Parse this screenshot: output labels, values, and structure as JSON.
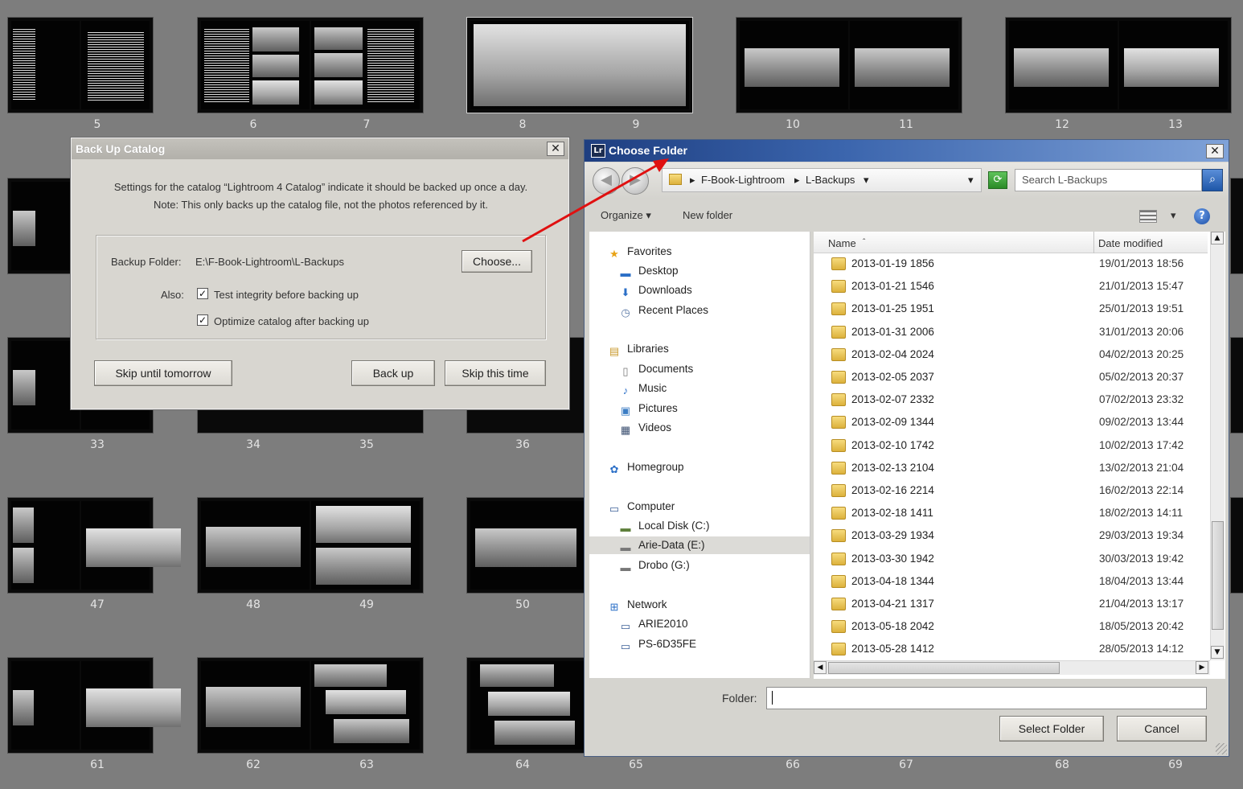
{
  "page_numbers": [
    "5",
    "6",
    "7",
    "8",
    "9",
    "10",
    "11",
    "12",
    "13",
    "33",
    "34",
    "35",
    "36",
    "47",
    "48",
    "49",
    "50",
    "61",
    "62",
    "63",
    "64",
    "65",
    "66",
    "67",
    "68",
    "69"
  ],
  "backup_dialog": {
    "title": "Back Up Catalog",
    "close": "✕",
    "message_line1": "Settings for the catalog “Lightroom 4 Catalog” indicate it should be backed up once a day.",
    "message_line2": "Note: This only backs up the catalog file, not the photos referenced by it.",
    "folder_label": "Backup Folder:",
    "folder_path": "E:\\F-Book-Lightroom\\L-Backups",
    "choose_button": "Choose...",
    "also_label": "Also:",
    "check_integrity": "Test integrity before backing up",
    "check_optimize": "Optimize catalog after backing up",
    "check_mark": "✓",
    "skip_tomorrow": "Skip until tomorrow",
    "back_up": "Back up",
    "skip_time": "Skip this time"
  },
  "choose_dialog": {
    "title": "Choose Folder",
    "app_badge": "Lr",
    "close": "✕",
    "back_glyph": "◀",
    "forward_glyph": "▶",
    "address": {
      "separator": "▸",
      "dropdown": "▾",
      "segments": [
        "F-Book-Lightroom",
        "L-Backups"
      ]
    },
    "refresh_glyph": "⟳",
    "search_placeholder": "Search L-Backups",
    "search_glyph": "⌕",
    "toolbar": {
      "organize": "Organize ▾",
      "new_folder": "New folder",
      "view_dropdown": "▾",
      "help": "?"
    },
    "nav": {
      "favorites": "Favorites",
      "desktop": "Desktop",
      "downloads": "Downloads",
      "recent": "Recent Places",
      "libraries": "Libraries",
      "documents": "Documents",
      "music": "Music",
      "pictures": "Pictures",
      "videos": "Videos",
      "homegroup": "Homegroup",
      "computer": "Computer",
      "local_disk": "Local Disk (C:)",
      "arie_data": "Arie-Data (E:)",
      "drobo": "Drobo (G:)",
      "network": "Network",
      "arie2010": "ARIE2010",
      "ps": "PS-6D35FE"
    },
    "columns": {
      "name": "Name",
      "sort": "ˆ",
      "date": "Date modified"
    },
    "scroll": {
      "up": "▲",
      "down": "▼",
      "left": "◀",
      "right": "▶"
    },
    "files": [
      {
        "name": "2013-01-19 1856",
        "date": "19/01/2013 18:56"
      },
      {
        "name": "2013-01-21 1546",
        "date": "21/01/2013 15:47"
      },
      {
        "name": "2013-01-25 1951",
        "date": "25/01/2013 19:51"
      },
      {
        "name": "2013-01-31 2006",
        "date": "31/01/2013 20:06"
      },
      {
        "name": "2013-02-04 2024",
        "date": "04/02/2013 20:25"
      },
      {
        "name": "2013-02-05 2037",
        "date": "05/02/2013 20:37"
      },
      {
        "name": "2013-02-07 2332",
        "date": "07/02/2013 23:32"
      },
      {
        "name": "2013-02-09 1344",
        "date": "09/02/2013 13:44"
      },
      {
        "name": "2013-02-10 1742",
        "date": "10/02/2013 17:42"
      },
      {
        "name": "2013-02-13 2104",
        "date": "13/02/2013 21:04"
      },
      {
        "name": "2013-02-16 2214",
        "date": "16/02/2013 22:14"
      },
      {
        "name": "2013-02-18 1411",
        "date": "18/02/2013 14:11"
      },
      {
        "name": "2013-03-29 1934",
        "date": "29/03/2013 19:34"
      },
      {
        "name": "2013-03-30 1942",
        "date": "30/03/2013 19:42"
      },
      {
        "name": "2013-04-18 1344",
        "date": "18/04/2013 13:44"
      },
      {
        "name": "2013-04-21 1317",
        "date": "21/04/2013 13:17"
      },
      {
        "name": "2013-05-18 2042",
        "date": "18/05/2013 20:42"
      },
      {
        "name": "2013-05-28 1412",
        "date": "28/05/2013 14:12"
      }
    ],
    "folder_label": "Folder:",
    "folder_value": "",
    "select_button": "Select Folder",
    "cancel_button": "Cancel"
  },
  "icons": {
    "star": "★",
    "desktop": "▬",
    "downloads": "⬇",
    "recent": "◷",
    "libraries": "▤",
    "document": "▯",
    "music": "♪",
    "pictures": "▣",
    "videos": "▦",
    "homegroup": "✿",
    "computer": "▭",
    "disk": "▬",
    "network": "⊞"
  },
  "colors": {
    "annotation_arrow": "#e01010",
    "titlebar_blue": "#2a4f94"
  }
}
